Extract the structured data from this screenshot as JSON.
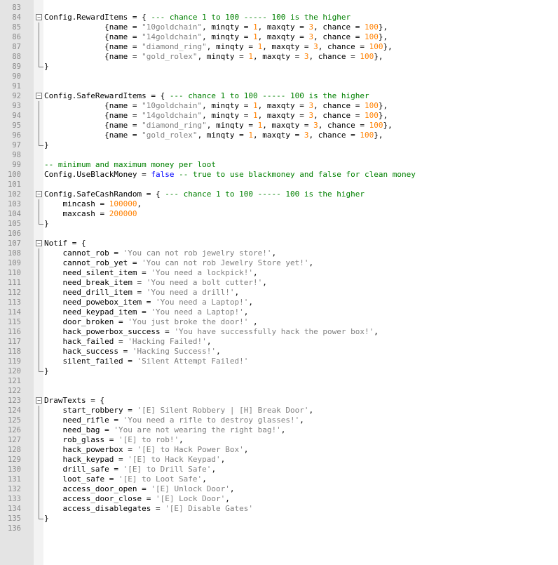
{
  "editor": {
    "lines": [
      {
        "n": "83",
        "segs": []
      },
      {
        "n": "84",
        "fold": "start",
        "segs": [
          [
            "id",
            "Config.RewardItems = { "
          ],
          [
            "cmt",
            "--- chance 1 to 100 ----- 100 is the higher"
          ]
        ]
      },
      {
        "n": "85",
        "fold": "mid",
        "segs": [
          [
            "id",
            "             {name = "
          ],
          [
            "str",
            "\"10goldchain\""
          ],
          [
            "id",
            ", minqty = "
          ],
          [
            "num",
            "1"
          ],
          [
            "id",
            ", maxqty = "
          ],
          [
            "num",
            "3"
          ],
          [
            "id",
            ", chance = "
          ],
          [
            "num",
            "100"
          ],
          [
            "id",
            "},"
          ]
        ]
      },
      {
        "n": "86",
        "fold": "mid",
        "segs": [
          [
            "id",
            "             {name = "
          ],
          [
            "str",
            "\"14goldchain\""
          ],
          [
            "id",
            ", minqty = "
          ],
          [
            "num",
            "1"
          ],
          [
            "id",
            ", maxqty = "
          ],
          [
            "num",
            "3"
          ],
          [
            "id",
            ", chance = "
          ],
          [
            "num",
            "100"
          ],
          [
            "id",
            "},"
          ]
        ]
      },
      {
        "n": "87",
        "fold": "mid",
        "segs": [
          [
            "id",
            "             {name = "
          ],
          [
            "str",
            "\"diamond_ring\""
          ],
          [
            "id",
            ", minqty = "
          ],
          [
            "num",
            "1"
          ],
          [
            "id",
            ", maxqty = "
          ],
          [
            "num",
            "3"
          ],
          [
            "id",
            ", chance = "
          ],
          [
            "num",
            "100"
          ],
          [
            "id",
            "},"
          ]
        ]
      },
      {
        "n": "88",
        "fold": "mid",
        "segs": [
          [
            "id",
            "             {name = "
          ],
          [
            "str",
            "\"gold_rolex\""
          ],
          [
            "id",
            ", minqty = "
          ],
          [
            "num",
            "1"
          ],
          [
            "id",
            ", maxqty = "
          ],
          [
            "num",
            "3"
          ],
          [
            "id",
            ", chance = "
          ],
          [
            "num",
            "100"
          ],
          [
            "id",
            "},"
          ]
        ]
      },
      {
        "n": "89",
        "fold": "end",
        "segs": [
          [
            "id",
            "}"
          ]
        ]
      },
      {
        "n": "90",
        "segs": []
      },
      {
        "n": "91",
        "segs": []
      },
      {
        "n": "92",
        "fold": "start",
        "segs": [
          [
            "id",
            "Config.SafeRewardItems = { "
          ],
          [
            "cmt",
            "--- chance 1 to 100 ----- 100 is the higher"
          ]
        ]
      },
      {
        "n": "93",
        "fold": "mid",
        "segs": [
          [
            "id",
            "             {name = "
          ],
          [
            "str",
            "\"10goldchain\""
          ],
          [
            "id",
            ", minqty = "
          ],
          [
            "num",
            "1"
          ],
          [
            "id",
            ", maxqty = "
          ],
          [
            "num",
            "3"
          ],
          [
            "id",
            ", chance = "
          ],
          [
            "num",
            "100"
          ],
          [
            "id",
            "},"
          ]
        ]
      },
      {
        "n": "94",
        "fold": "mid",
        "segs": [
          [
            "id",
            "             {name = "
          ],
          [
            "str",
            "\"14goldchain\""
          ],
          [
            "id",
            ", minqty = "
          ],
          [
            "num",
            "1"
          ],
          [
            "id",
            ", maxqty = "
          ],
          [
            "num",
            "3"
          ],
          [
            "id",
            ", chance = "
          ],
          [
            "num",
            "100"
          ],
          [
            "id",
            "},"
          ]
        ]
      },
      {
        "n": "95",
        "fold": "mid",
        "segs": [
          [
            "id",
            "             {name = "
          ],
          [
            "str",
            "\"diamond_ring\""
          ],
          [
            "id",
            ", minqty = "
          ],
          [
            "num",
            "1"
          ],
          [
            "id",
            ", maxqty = "
          ],
          [
            "num",
            "3"
          ],
          [
            "id",
            ", chance = "
          ],
          [
            "num",
            "100"
          ],
          [
            "id",
            "},"
          ]
        ]
      },
      {
        "n": "96",
        "fold": "mid",
        "segs": [
          [
            "id",
            "             {name = "
          ],
          [
            "str",
            "\"gold_rolex\""
          ],
          [
            "id",
            ", minqty = "
          ],
          [
            "num",
            "1"
          ],
          [
            "id",
            ", maxqty = "
          ],
          [
            "num",
            "3"
          ],
          [
            "id",
            ", chance = "
          ],
          [
            "num",
            "100"
          ],
          [
            "id",
            "},"
          ]
        ]
      },
      {
        "n": "97",
        "fold": "end",
        "segs": [
          [
            "id",
            "}"
          ]
        ]
      },
      {
        "n": "98",
        "segs": []
      },
      {
        "n": "99",
        "segs": [
          [
            "cmt",
            "-- minimum and maximum money per loot"
          ]
        ]
      },
      {
        "n": "100",
        "segs": [
          [
            "id",
            "Config.UseBlackMoney = "
          ],
          [
            "kw",
            "false"
          ],
          [
            "cmt",
            " -- true to use blackmoney and false for clean money"
          ]
        ]
      },
      {
        "n": "101",
        "segs": []
      },
      {
        "n": "102",
        "fold": "start",
        "segs": [
          [
            "id",
            "Config.SafeCashRandom = { "
          ],
          [
            "cmt",
            "--- chance 1 to 100 ----- 100 is the higher"
          ]
        ]
      },
      {
        "n": "103",
        "fold": "mid",
        "segs": [
          [
            "id",
            "    mincash = "
          ],
          [
            "num",
            "100000"
          ],
          [
            "id",
            ","
          ]
        ]
      },
      {
        "n": "104",
        "fold": "mid",
        "segs": [
          [
            "id",
            "    maxcash = "
          ],
          [
            "num",
            "200000"
          ]
        ]
      },
      {
        "n": "105",
        "fold": "end",
        "segs": [
          [
            "id",
            "}"
          ]
        ]
      },
      {
        "n": "106",
        "segs": []
      },
      {
        "n": "107",
        "fold": "start",
        "segs": [
          [
            "id",
            "Notif = {"
          ]
        ]
      },
      {
        "n": "108",
        "fold": "mid",
        "segs": [
          [
            "id",
            "    cannot_rob = "
          ],
          [
            "str",
            "'You can not rob jewelry store!'"
          ],
          [
            "id",
            ","
          ]
        ]
      },
      {
        "n": "109",
        "fold": "mid",
        "segs": [
          [
            "id",
            "    cannot_rob_yet = "
          ],
          [
            "str",
            "'You can not rob Jewelry Store yet!'"
          ],
          [
            "id",
            ","
          ]
        ]
      },
      {
        "n": "110",
        "fold": "mid",
        "segs": [
          [
            "id",
            "    need_silent_item = "
          ],
          [
            "str",
            "'You need a lockpick!'"
          ],
          [
            "id",
            ","
          ]
        ]
      },
      {
        "n": "111",
        "fold": "mid",
        "segs": [
          [
            "id",
            "    need_break_item = "
          ],
          [
            "str",
            "'You need a bolt cutter!'"
          ],
          [
            "id",
            ","
          ]
        ]
      },
      {
        "n": "112",
        "fold": "mid",
        "segs": [
          [
            "id",
            "    need_drill_item = "
          ],
          [
            "str",
            "'You need a drill!'"
          ],
          [
            "id",
            ","
          ]
        ]
      },
      {
        "n": "113",
        "fold": "mid",
        "segs": [
          [
            "id",
            "    need_powebox_item = "
          ],
          [
            "str",
            "'You need a Laptop!'"
          ],
          [
            "id",
            ","
          ]
        ]
      },
      {
        "n": "114",
        "fold": "mid",
        "segs": [
          [
            "id",
            "    need_keypad_item = "
          ],
          [
            "str",
            "'You need a Laptop!'"
          ],
          [
            "id",
            ","
          ]
        ]
      },
      {
        "n": "115",
        "fold": "mid",
        "segs": [
          [
            "id",
            "    door_broken = "
          ],
          [
            "str",
            "'You just broke the door!'"
          ],
          [
            "id",
            " ,"
          ]
        ]
      },
      {
        "n": "116",
        "fold": "mid",
        "segs": [
          [
            "id",
            "    hack_powerbox_success = "
          ],
          [
            "str",
            "'You have successfully hack the power box!'"
          ],
          [
            "id",
            ","
          ]
        ]
      },
      {
        "n": "117",
        "fold": "mid",
        "segs": [
          [
            "id",
            "    hack_failed = "
          ],
          [
            "str",
            "'Hacking Failed!'"
          ],
          [
            "id",
            ","
          ]
        ]
      },
      {
        "n": "118",
        "fold": "mid",
        "segs": [
          [
            "id",
            "    hack_success = "
          ],
          [
            "str",
            "'Hacking Success!'"
          ],
          [
            "id",
            ","
          ]
        ]
      },
      {
        "n": "119",
        "fold": "mid",
        "segs": [
          [
            "id",
            "    silent_failed = "
          ],
          [
            "str",
            "'Silent Attempt Failed!'"
          ]
        ]
      },
      {
        "n": "120",
        "fold": "end",
        "segs": [
          [
            "id",
            "}"
          ]
        ]
      },
      {
        "n": "121",
        "segs": []
      },
      {
        "n": "122",
        "segs": []
      },
      {
        "n": "123",
        "fold": "start",
        "segs": [
          [
            "id",
            "DrawTexts = {"
          ]
        ]
      },
      {
        "n": "124",
        "fold": "mid",
        "segs": [
          [
            "id",
            "    start_robbery = "
          ],
          [
            "str",
            "'[E] Silent Robbery | [H] Break Door'"
          ],
          [
            "id",
            ","
          ]
        ]
      },
      {
        "n": "125",
        "fold": "mid",
        "segs": [
          [
            "id",
            "    need_rifle = "
          ],
          [
            "str",
            "'You need a rifle to destroy glasses!'"
          ],
          [
            "id",
            ","
          ]
        ]
      },
      {
        "n": "126",
        "fold": "mid",
        "segs": [
          [
            "id",
            "    need_bag = "
          ],
          [
            "str",
            "'You are not wearing the right bag!'"
          ],
          [
            "id",
            ","
          ]
        ]
      },
      {
        "n": "127",
        "fold": "mid",
        "segs": [
          [
            "id",
            "    rob_glass = "
          ],
          [
            "str",
            "'[E] to rob!'"
          ],
          [
            "id",
            ","
          ]
        ]
      },
      {
        "n": "128",
        "fold": "mid",
        "segs": [
          [
            "id",
            "    hack_powerbox = "
          ],
          [
            "str",
            "'[E] to Hack Power Box'"
          ],
          [
            "id",
            ","
          ]
        ]
      },
      {
        "n": "129",
        "fold": "mid",
        "segs": [
          [
            "id",
            "    hack_keypad = "
          ],
          [
            "str",
            "'[E] to Hack Keypad'"
          ],
          [
            "id",
            ","
          ]
        ]
      },
      {
        "n": "130",
        "fold": "mid",
        "segs": [
          [
            "id",
            "    drill_safe = "
          ],
          [
            "str",
            "'[E] to Drill Safe'"
          ],
          [
            "id",
            ","
          ]
        ]
      },
      {
        "n": "131",
        "fold": "mid",
        "segs": [
          [
            "id",
            "    loot_safe = "
          ],
          [
            "str",
            "'[E] to Loot Safe'"
          ],
          [
            "id",
            ","
          ]
        ]
      },
      {
        "n": "132",
        "fold": "mid",
        "segs": [
          [
            "id",
            "    access_door_open = "
          ],
          [
            "str",
            "'[E] Unlock Door'"
          ],
          [
            "id",
            ","
          ]
        ]
      },
      {
        "n": "133",
        "fold": "mid",
        "segs": [
          [
            "id",
            "    access_door_close = "
          ],
          [
            "str",
            "'[E] Lock Door'"
          ],
          [
            "id",
            ","
          ]
        ]
      },
      {
        "n": "134",
        "fold": "mid",
        "segs": [
          [
            "id",
            "    access_disablegates = "
          ],
          [
            "str",
            "'[E] Disable Gates'"
          ]
        ]
      },
      {
        "n": "135",
        "fold": "end",
        "segs": [
          [
            "id",
            "}"
          ]
        ]
      },
      {
        "n": "136",
        "segs": []
      }
    ]
  }
}
